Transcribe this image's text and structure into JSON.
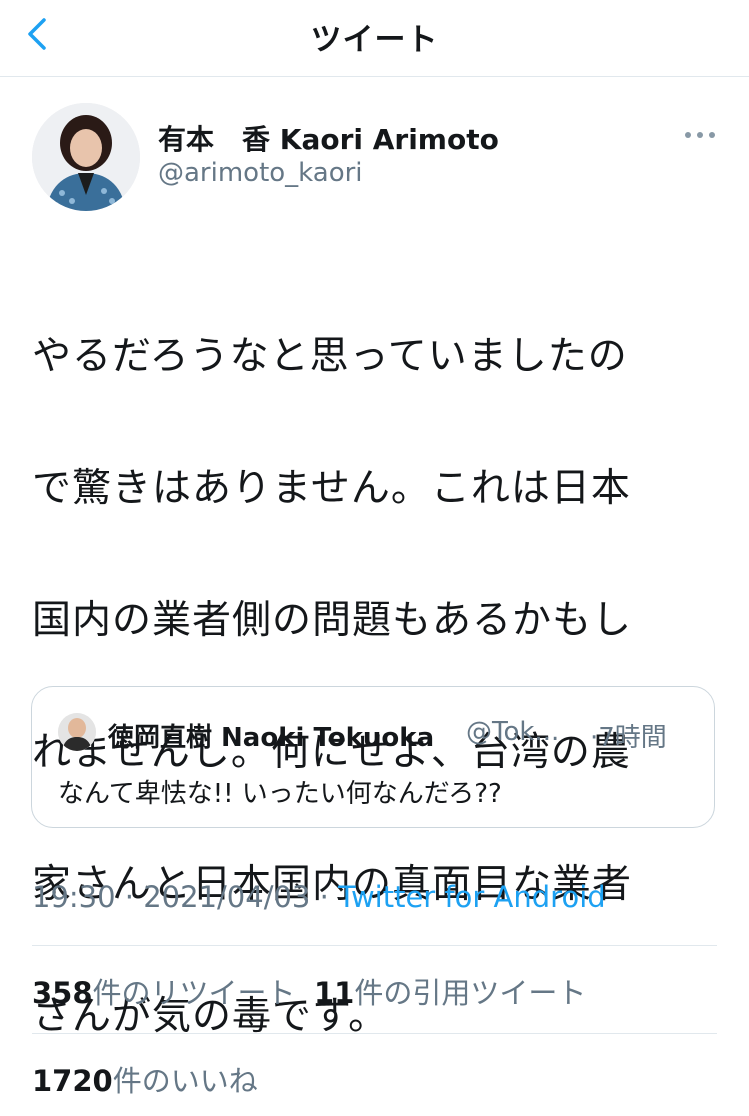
{
  "header": {
    "title": "ツイート"
  },
  "tweet": {
    "display_name": "有本　香  Kaori Arimoto",
    "handle": "@arimoto_kaori",
    "text_lines": [
      "やるだろうなと思っていましたの",
      "で驚きはありません。これは日本",
      "国内の業者側の問題もあるかもし",
      "れませんし。何にせよ、台湾の農",
      "家さんと日本国内の真面目な業者",
      "さんが気の毒です。"
    ],
    "time": "19:30 · 2021/04/03 · ",
    "source": "Twitter for Android"
  },
  "quote": {
    "name": "徳岡直樹 Naoki Tokuoka",
    "handle": "@Tok...",
    "time": "·7時間",
    "text": "なんて卑怯な!!  いったい何なんだろ??"
  },
  "stats": {
    "retweets_count": "358",
    "retweets_label": "件のリツイート",
    "quotes_count": "11",
    "quotes_label": "件の引用ツイート",
    "likes_count": "1720",
    "likes_label": "件のいいね"
  },
  "colors": {
    "link": "#1da1f2",
    "secondary": "#657786",
    "text": "#14171a",
    "border": "#e1e8ed"
  },
  "icons": {
    "back": "chevron-left-icon",
    "more": "more-horizontal-icon"
  }
}
